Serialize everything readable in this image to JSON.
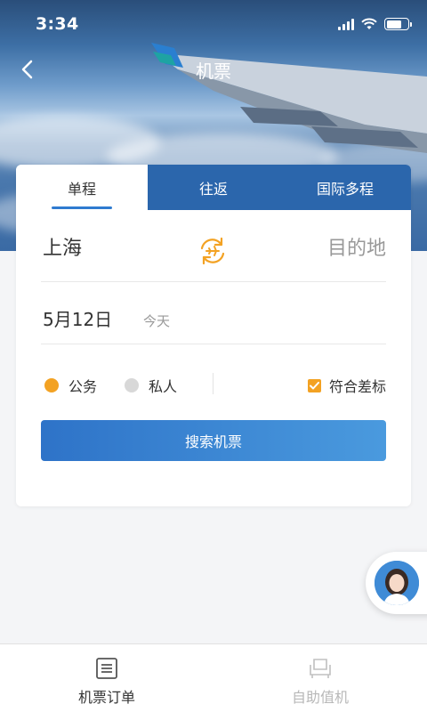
{
  "status_bar": {
    "time": "3:34"
  },
  "nav": {
    "title": "机票"
  },
  "tabs": [
    {
      "label": "单程"
    },
    {
      "label": "往返"
    },
    {
      "label": "国际多程"
    }
  ],
  "route": {
    "from": "上海",
    "to": "目的地"
  },
  "date": {
    "day": "5月12日",
    "sub": "今天"
  },
  "trip_types": [
    {
      "label": "公务",
      "color": "#f3a223",
      "selected": true
    },
    {
      "label": "私人",
      "color": "#d8d8d8",
      "selected": false
    }
  ],
  "policy_check": {
    "label": "符合差标",
    "checked": true
  },
  "search_button": {
    "label": "搜索机票"
  },
  "bottom_nav": [
    {
      "label": "机票订单",
      "icon": "list-icon",
      "active": true
    },
    {
      "label": "自助值机",
      "icon": "seat-icon",
      "active": false
    }
  ],
  "colors": {
    "accent": "#2f7bd0",
    "orange": "#f3a223",
    "tab_bg": "#2b66ac"
  }
}
